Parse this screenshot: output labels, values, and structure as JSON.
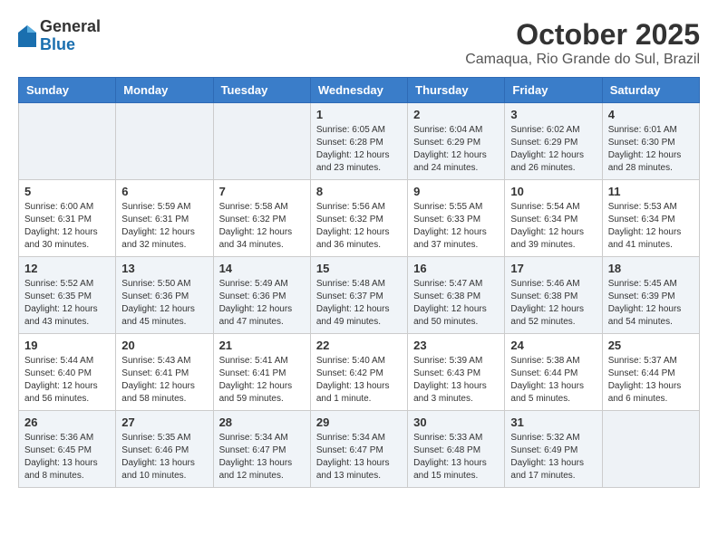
{
  "header": {
    "logo_general": "General",
    "logo_blue": "Blue",
    "month_title": "October 2025",
    "location": "Camaqua, Rio Grande do Sul, Brazil"
  },
  "weekdays": [
    "Sunday",
    "Monday",
    "Tuesday",
    "Wednesday",
    "Thursday",
    "Friday",
    "Saturday"
  ],
  "weeks": [
    [
      {
        "day": "",
        "info": ""
      },
      {
        "day": "",
        "info": ""
      },
      {
        "day": "",
        "info": ""
      },
      {
        "day": "1",
        "info": "Sunrise: 6:05 AM\nSunset: 6:28 PM\nDaylight: 12 hours\nand 23 minutes."
      },
      {
        "day": "2",
        "info": "Sunrise: 6:04 AM\nSunset: 6:29 PM\nDaylight: 12 hours\nand 24 minutes."
      },
      {
        "day": "3",
        "info": "Sunrise: 6:02 AM\nSunset: 6:29 PM\nDaylight: 12 hours\nand 26 minutes."
      },
      {
        "day": "4",
        "info": "Sunrise: 6:01 AM\nSunset: 6:30 PM\nDaylight: 12 hours\nand 28 minutes."
      }
    ],
    [
      {
        "day": "5",
        "info": "Sunrise: 6:00 AM\nSunset: 6:31 PM\nDaylight: 12 hours\nand 30 minutes."
      },
      {
        "day": "6",
        "info": "Sunrise: 5:59 AM\nSunset: 6:31 PM\nDaylight: 12 hours\nand 32 minutes."
      },
      {
        "day": "7",
        "info": "Sunrise: 5:58 AM\nSunset: 6:32 PM\nDaylight: 12 hours\nand 34 minutes."
      },
      {
        "day": "8",
        "info": "Sunrise: 5:56 AM\nSunset: 6:32 PM\nDaylight: 12 hours\nand 36 minutes."
      },
      {
        "day": "9",
        "info": "Sunrise: 5:55 AM\nSunset: 6:33 PM\nDaylight: 12 hours\nand 37 minutes."
      },
      {
        "day": "10",
        "info": "Sunrise: 5:54 AM\nSunset: 6:34 PM\nDaylight: 12 hours\nand 39 minutes."
      },
      {
        "day": "11",
        "info": "Sunrise: 5:53 AM\nSunset: 6:34 PM\nDaylight: 12 hours\nand 41 minutes."
      }
    ],
    [
      {
        "day": "12",
        "info": "Sunrise: 5:52 AM\nSunset: 6:35 PM\nDaylight: 12 hours\nand 43 minutes."
      },
      {
        "day": "13",
        "info": "Sunrise: 5:50 AM\nSunset: 6:36 PM\nDaylight: 12 hours\nand 45 minutes."
      },
      {
        "day": "14",
        "info": "Sunrise: 5:49 AM\nSunset: 6:36 PM\nDaylight: 12 hours\nand 47 minutes."
      },
      {
        "day": "15",
        "info": "Sunrise: 5:48 AM\nSunset: 6:37 PM\nDaylight: 12 hours\nand 49 minutes."
      },
      {
        "day": "16",
        "info": "Sunrise: 5:47 AM\nSunset: 6:38 PM\nDaylight: 12 hours\nand 50 minutes."
      },
      {
        "day": "17",
        "info": "Sunrise: 5:46 AM\nSunset: 6:38 PM\nDaylight: 12 hours\nand 52 minutes."
      },
      {
        "day": "18",
        "info": "Sunrise: 5:45 AM\nSunset: 6:39 PM\nDaylight: 12 hours\nand 54 minutes."
      }
    ],
    [
      {
        "day": "19",
        "info": "Sunrise: 5:44 AM\nSunset: 6:40 PM\nDaylight: 12 hours\nand 56 minutes."
      },
      {
        "day": "20",
        "info": "Sunrise: 5:43 AM\nSunset: 6:41 PM\nDaylight: 12 hours\nand 58 minutes."
      },
      {
        "day": "21",
        "info": "Sunrise: 5:41 AM\nSunset: 6:41 PM\nDaylight: 12 hours\nand 59 minutes."
      },
      {
        "day": "22",
        "info": "Sunrise: 5:40 AM\nSunset: 6:42 PM\nDaylight: 13 hours\nand 1 minute."
      },
      {
        "day": "23",
        "info": "Sunrise: 5:39 AM\nSunset: 6:43 PM\nDaylight: 13 hours\nand 3 minutes."
      },
      {
        "day": "24",
        "info": "Sunrise: 5:38 AM\nSunset: 6:44 PM\nDaylight: 13 hours\nand 5 minutes."
      },
      {
        "day": "25",
        "info": "Sunrise: 5:37 AM\nSunset: 6:44 PM\nDaylight: 13 hours\nand 6 minutes."
      }
    ],
    [
      {
        "day": "26",
        "info": "Sunrise: 5:36 AM\nSunset: 6:45 PM\nDaylight: 13 hours\nand 8 minutes."
      },
      {
        "day": "27",
        "info": "Sunrise: 5:35 AM\nSunset: 6:46 PM\nDaylight: 13 hours\nand 10 minutes."
      },
      {
        "day": "28",
        "info": "Sunrise: 5:34 AM\nSunset: 6:47 PM\nDaylight: 13 hours\nand 12 minutes."
      },
      {
        "day": "29",
        "info": "Sunrise: 5:34 AM\nSunset: 6:47 PM\nDaylight: 13 hours\nand 13 minutes."
      },
      {
        "day": "30",
        "info": "Sunrise: 5:33 AM\nSunset: 6:48 PM\nDaylight: 13 hours\nand 15 minutes."
      },
      {
        "day": "31",
        "info": "Sunrise: 5:32 AM\nSunset: 6:49 PM\nDaylight: 13 hours\nand 17 minutes."
      },
      {
        "day": "",
        "info": ""
      }
    ]
  ]
}
